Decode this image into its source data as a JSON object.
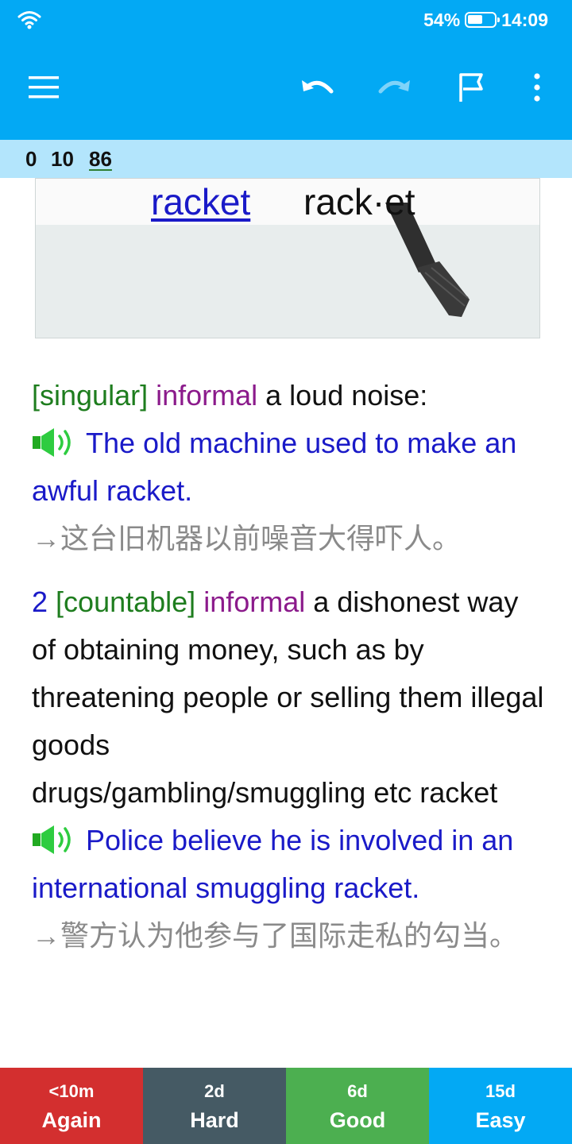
{
  "status": {
    "battery_pct": "54%",
    "time": "14:09"
  },
  "toolbar": {
    "menu_icon": "hamburger-menu-icon",
    "undo_icon": "undo-icon",
    "redo_icon": "redo-icon",
    "flag_icon": "flag-icon",
    "more_icon": "more-vertical-icon"
  },
  "counts": {
    "new": "0",
    "learning": "10",
    "review": "86"
  },
  "card": {
    "headword": "racket",
    "pronunciation": "rack·et",
    "sense1": {
      "grammar": "[singular]",
      "register": "informal",
      "definition": "a loud noise:",
      "example": "The old machine used to make an awful racket.",
      "translation": "→这台旧机器以前噪音大得吓人。"
    },
    "sense2": {
      "number": "2",
      "grammar": "[countable]",
      "register": "informal",
      "definition": "a dishonest way of obtaining money, such as by threatening people or selling them illegal goods",
      "collocation": "drugs/gambling/smuggling etc racket",
      "example": "Police believe he is involved in an international smuggling racket.",
      "translation": "→警方认为他参与了国际走私的勾当。"
    }
  },
  "answers": [
    {
      "interval": "<10m",
      "label": "Again",
      "color": "#d32f2f"
    },
    {
      "interval": "2d",
      "label": "Hard",
      "color": "#455a64"
    },
    {
      "interval": "6d",
      "label": "Good",
      "color": "#4caf50"
    },
    {
      "interval": "15d",
      "label": "Easy",
      "color": "#03a9f4"
    }
  ],
  "colors": {
    "accent": "#03a9f4",
    "counts_bar": "#b3e5fc",
    "example_blue": "#1a1ac8",
    "grammar_green": "#1e7d1e",
    "register_purple": "#8b1a8b"
  }
}
